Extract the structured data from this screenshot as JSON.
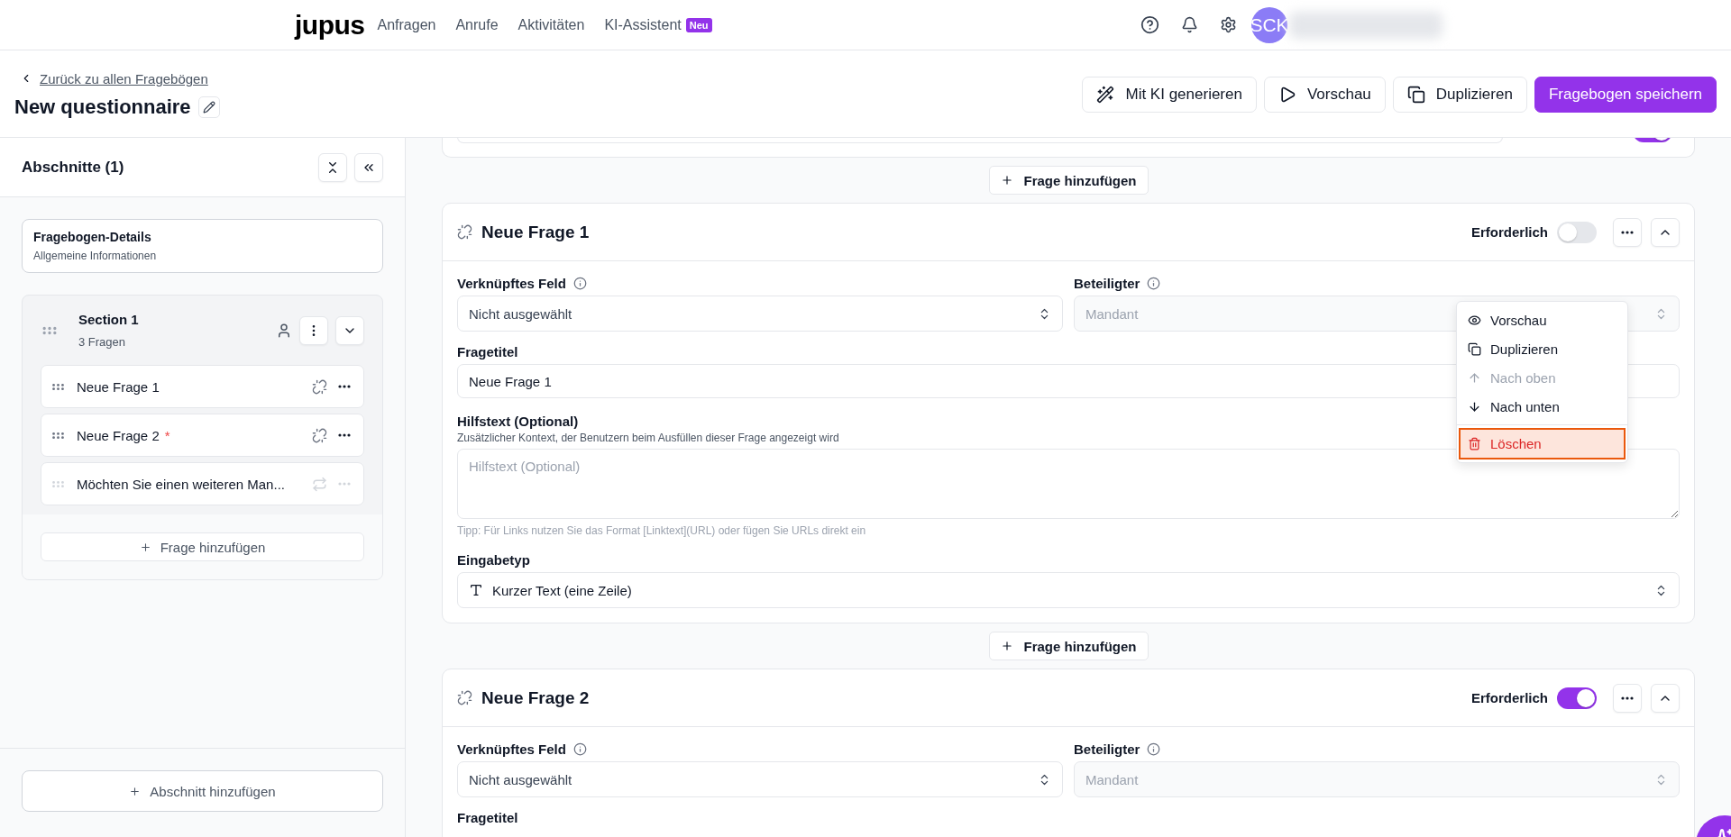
{
  "nav": {
    "logo": "jupus",
    "items": [
      {
        "label": "Anfragen"
      },
      {
        "label": "Anrufe"
      },
      {
        "label": "Aktivitäten"
      },
      {
        "label": "KI-Assistent",
        "badge": "Neu"
      }
    ],
    "avatar": "SCK"
  },
  "header": {
    "back_link": "Zurück zu allen Fragebögen",
    "title": "New questionnaire",
    "actions": [
      {
        "label": "Mit KI generieren",
        "kind": "ai"
      },
      {
        "label": "Vorschau",
        "kind": "preview"
      },
      {
        "label": "Duplizieren",
        "kind": "duplicate"
      },
      {
        "label": "Fragebogen speichern",
        "kind": "primary"
      }
    ]
  },
  "sidebar": {
    "title": "Abschnitte (1)",
    "details": {
      "title": "Fragebogen-Details",
      "subtitle": "Allgemeine Informationen"
    },
    "sections": [
      {
        "title": "Section 1",
        "count": "3 Fragen",
        "expanded": true,
        "add_question": "Frage hinzufügen",
        "questions": [
          {
            "label": "Neue Frage 1",
            "kind": "unlinked",
            "disabled": false
          },
          {
            "label": "Neue Frage 2",
            "kind": "unlinked",
            "required_mark": "*",
            "disabled": false
          },
          {
            "label": "Möchten Sie einen weiteren Man...",
            "kind": "repeat",
            "disabled": true
          }
        ]
      }
    ],
    "add_section": "Abschnitt hinzufügen"
  },
  "main": {
    "previous_question": {
      "required": true
    },
    "add_question_labels": [
      "Frage hinzufügen",
      "Frage hinzufügen"
    ],
    "questions": [
      {
        "title": "Neue Frage 1",
        "required_label": "Erforderlich",
        "required": false,
        "expanded": true,
        "linked_field_label": "Verknüpftes Feld",
        "linked_field_value": "Nicht ausgewählt",
        "participant_label": "Beteiligter",
        "participant_value": "Mandant",
        "title_label": "Fragetitel",
        "title_value": "Neue Frage 1",
        "help_label": "Hilfstext (Optional)",
        "help_description": "Zusätzlicher Kontext, der Benutzern beim Ausfüllen dieser Frage angezeigt wird",
        "help_placeholder": "Hilfstext (Optional)",
        "tip": "Tipp: Für Links nutzen Sie das Format [Linktext](URL) oder fügen Sie URLs direkt ein",
        "input_type_label": "Eingabetyp",
        "input_type_value": "Kurzer Text (eine Zeile)",
        "menu": [
          {
            "label": "Vorschau",
            "kind": "preview",
            "disabled": false,
            "selected": false
          },
          {
            "label": "Duplizieren",
            "kind": "duplicate",
            "disabled": false,
            "selected": false
          },
          {
            "label": "Nach oben",
            "kind": "up",
            "disabled": true,
            "selected": false
          },
          {
            "label": "Nach unten",
            "kind": "down",
            "disabled": false,
            "selected": false
          },
          {
            "label": "Löschen",
            "kind": "delete",
            "disabled": false,
            "selected": true
          }
        ]
      },
      {
        "title": "Neue Frage 2",
        "required_label": "Erforderlich",
        "required": true,
        "expanded": true,
        "linked_field_label": "Verknüpftes Feld",
        "linked_field_value": "Nicht ausgewählt",
        "participant_label": "Beteiligter",
        "participant_value": "Mandant",
        "title_label": "Fragetitel"
      }
    ]
  }
}
